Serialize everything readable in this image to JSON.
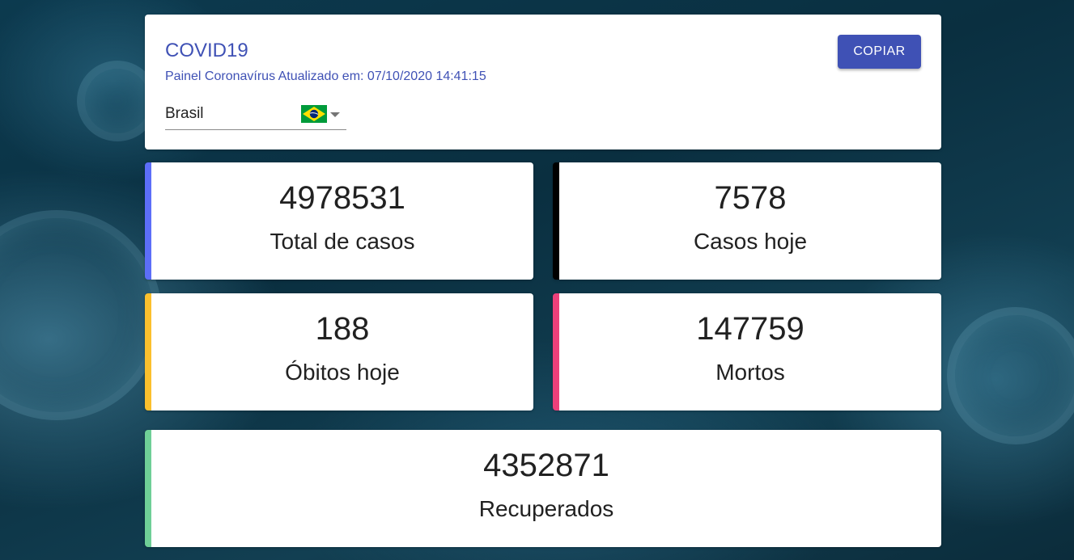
{
  "header": {
    "title": "COVID19",
    "subtitle": "Painel Coronavírus Atualizado em: 07/10/2020 14:41:15",
    "copy_button": "COPIAR",
    "country": {
      "selected": "Brasil",
      "flag_icon": "brazil-flag-icon"
    }
  },
  "stats": {
    "total_cases": {
      "value": "4978531",
      "label": "Total de casos",
      "color": "#5c6ef8"
    },
    "cases_today": {
      "value": "7578",
      "label": "Casos hoje",
      "color": "#000000"
    },
    "deaths_today": {
      "value": "188",
      "label": "Óbitos hoje",
      "color": "#fbc02d"
    },
    "deaths": {
      "value": "147759",
      "label": "Mortos",
      "color": "#ec407a"
    },
    "recovered": {
      "value": "4352871",
      "label": "Recuperados",
      "color": "#6fcf97"
    }
  },
  "colors": {
    "accent": "#3f51b5"
  }
}
